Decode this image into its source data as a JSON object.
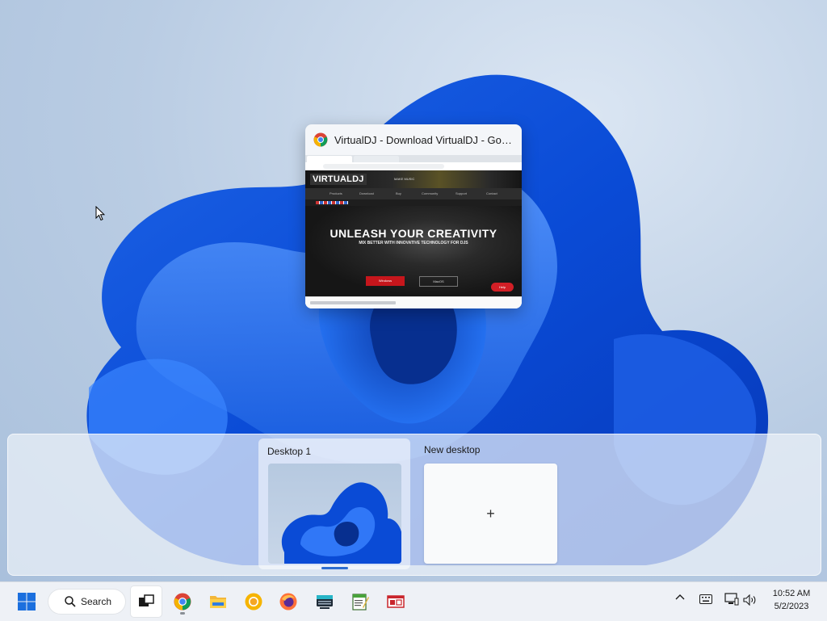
{
  "window": {
    "title": "VirtualDJ - Download VirtualDJ - Googl...",
    "page": {
      "logo": "VIRTUALDJ",
      "slogan": "MAKE MUSIC",
      "nav": [
        "Products",
        "Download",
        "Buy",
        "Community",
        "Support",
        "Contact"
      ],
      "hero_title": "UNLEASH YOUR CREATIVITY",
      "hero_subtitle": "MIX BETTER WITH INNOVATIVE TECHNOLOGY FOR DJS",
      "btn_windows": "Windows",
      "btn_mac": "MacOS",
      "btn_help": "Help"
    }
  },
  "desktops": {
    "current": "Desktop 1",
    "new_label": "New desktop",
    "new_symbol": "+"
  },
  "taskbar": {
    "search_label": "Search",
    "apps": [
      "start-icon",
      "task-view-icon",
      "chrome-icon",
      "file-explorer-icon",
      "chrome-canary-icon",
      "firefox-icon",
      "keyboard-app-icon",
      "notepad-icon",
      "window-app-icon"
    ],
    "clock_time": "10:52 AM",
    "clock_date": "5/2/2023"
  }
}
